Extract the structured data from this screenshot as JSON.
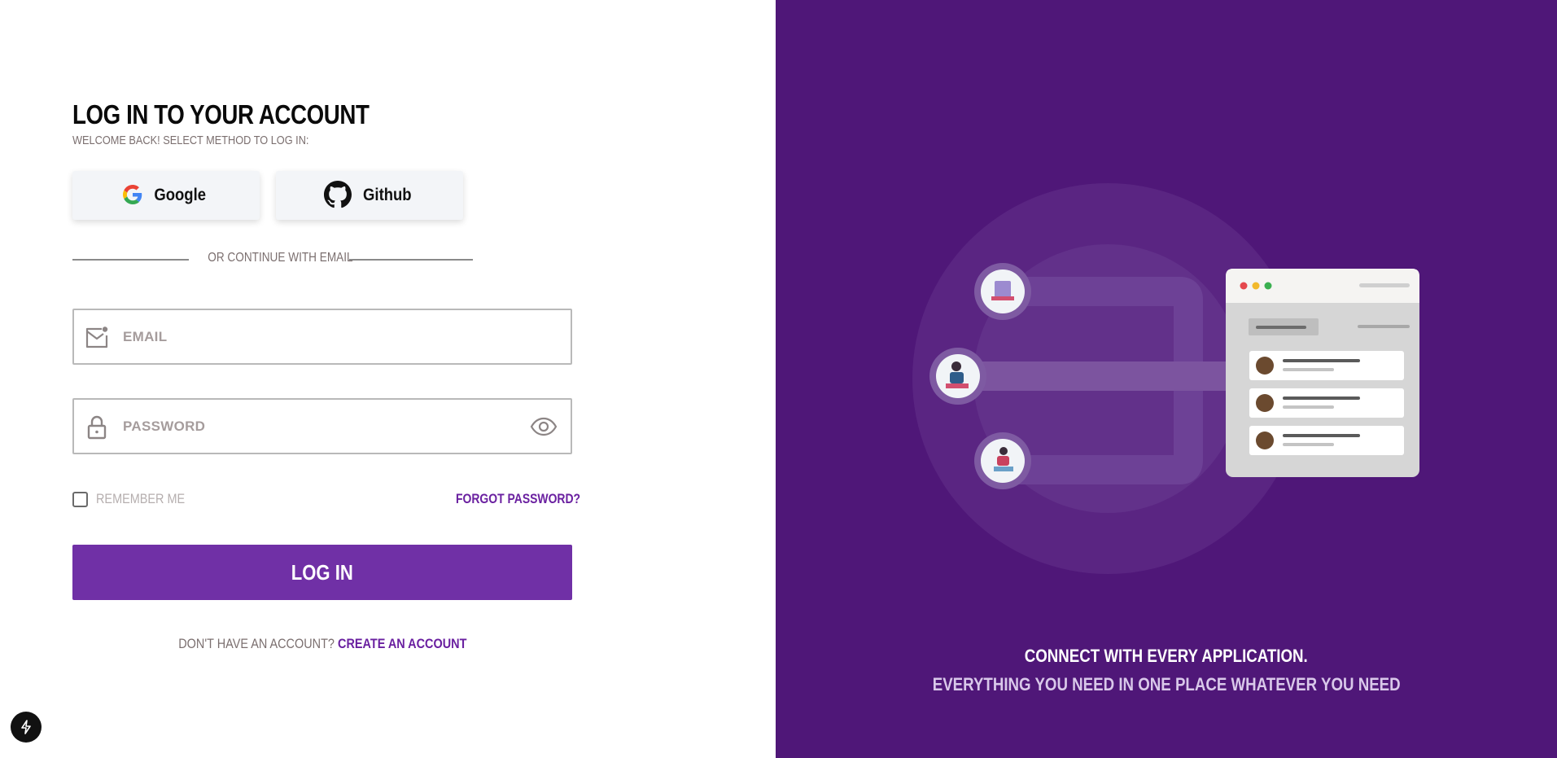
{
  "login": {
    "title": "LOG IN TO YOUR ACCOUNT",
    "subtitle": "WELCOME BACK! SELECT METHOD TO LOG IN:",
    "google_label": "Google",
    "github_label": "Github",
    "divider_text": "OR CONTINUE WITH EMAIL",
    "email_placeholder": "EMAIL",
    "password_placeholder": "PASSWORD",
    "remember_label": "REMEMBER ME",
    "forgot_label": "FORGOT PASSWORD?",
    "login_button": "LOG IN",
    "signup_question": "DON'T HAVE AN ACCOUNT?",
    "signup_link": "CREATE AN ACCOUNT"
  },
  "promo": {
    "headline": "CONNECT WITH EVERY APPLICATION.",
    "subline": "EVERYTHING YOU NEED IN ONE PLACE WHATEVER YOU NEED"
  },
  "icons": {
    "email": "mail-icon",
    "password": "lock-icon",
    "toggle": "eye-icon",
    "google": "google-logo",
    "github": "github-logo",
    "dev": "bolt-icon"
  },
  "colors": {
    "accent": "#7030a6",
    "panel": "#4f1778",
    "link": "#6a20a0"
  }
}
